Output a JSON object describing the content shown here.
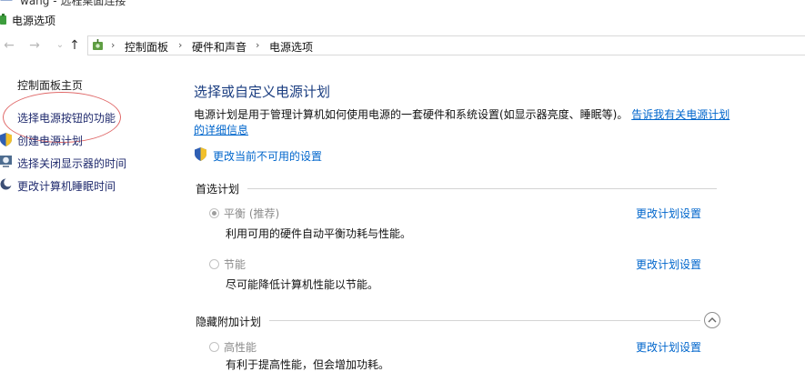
{
  "window": {
    "cropped_title": "wang - 远程桌面连接",
    "title": "电源选项"
  },
  "breadcrumb": {
    "items": [
      "控制面板",
      "硬件和声音",
      "电源选项"
    ],
    "separator": "›"
  },
  "nav": {
    "back_icon": "arrow-left-icon",
    "forward_icon": "arrow-right-icon",
    "recent_icon": "chevron-down-icon",
    "up_icon": "arrow-up-icon"
  },
  "sidebar": {
    "home": "控制面板主页",
    "items": [
      {
        "label": "选择电源按钮的功能",
        "icon": ""
      },
      {
        "label": "创建电源计划",
        "icon": "shield-icon"
      },
      {
        "label": "选择关闭显示器的时间",
        "icon": "monitor-clock-icon"
      },
      {
        "label": "更改计算机睡眠时间",
        "icon": "moon-icon"
      }
    ]
  },
  "main": {
    "heading": "选择或自定义电源计划",
    "description": "电源计划是用于管理计算机如何使用电源的一套硬件和系统设置(如显示器亮度、睡眠等)。",
    "description_link": "告诉我有关电源计划的详细信息",
    "change_unavailable": "更改当前不可用的设置",
    "preferred_title": "首选计划",
    "hidden_title": "隐藏附加计划",
    "plans": [
      {
        "name": "平衡 (推荐)",
        "desc": "利用可用的硬件自动平衡功耗与性能。",
        "link": "更改计划设置",
        "checked": true
      },
      {
        "name": "节能",
        "desc": "尽可能降低计算机性能以节能。",
        "link": "更改计划设置",
        "checked": false
      }
    ],
    "hidden_plans": [
      {
        "name": "高性能",
        "desc": "有利于提高性能，但会增加功耗。",
        "link": "更改计划设置",
        "checked": false
      }
    ]
  },
  "colors": {
    "accent": "#0066cc",
    "heading": "#1a3d80",
    "annotation": "#e06a6a"
  }
}
